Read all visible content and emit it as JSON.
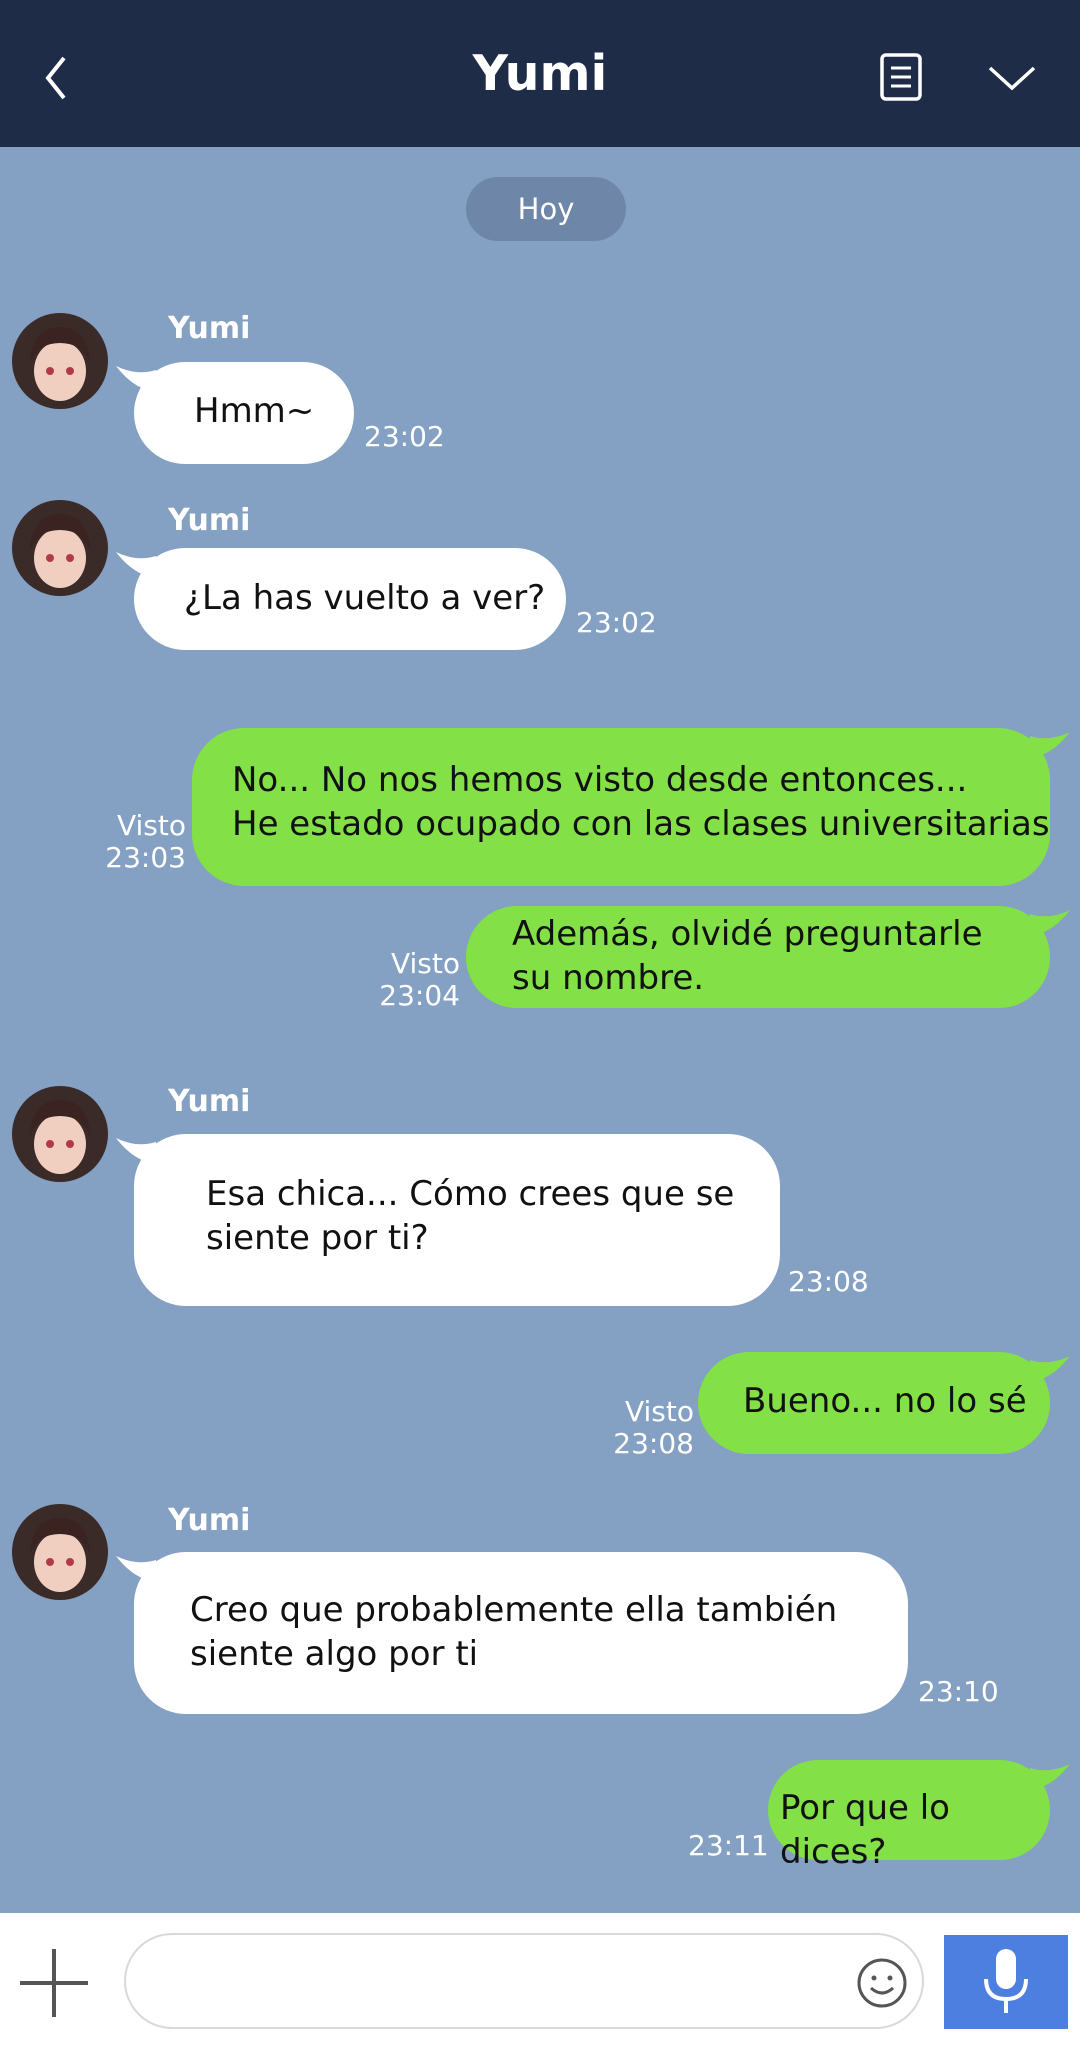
{
  "header": {
    "title": "Yumi",
    "back_icon": "chevron-left-icon",
    "notes_icon": "notes-icon",
    "menu_icon": "chevron-down-icon"
  },
  "chat": {
    "date_label": "Hoy",
    "messages": [
      {
        "sender": "Yumi",
        "text": "Hmm~",
        "time": "23:02"
      },
      {
        "sender": "Yumi",
        "text": "¿La has vuelto a ver?",
        "time": "23:02"
      },
      {
        "lines": [
          "No... No nos hemos visto desde entonces...",
          "He estado ocupado con las clases universitarias"
        ],
        "status": "Visto",
        "time": "23:03"
      },
      {
        "lines": [
          "Además, olvidé preguntarle",
          "su nombre."
        ],
        "status": "Visto",
        "time": "23:04"
      },
      {
        "sender": "Yumi",
        "lines": [
          "Esa chica... Cómo crees que se",
          "siente por ti?"
        ],
        "time": "23:08"
      },
      {
        "text": "Bueno... no lo sé",
        "status": "Visto",
        "time": "23:08"
      },
      {
        "sender": "Yumi",
        "lines": [
          "Creo que probablemente ella también",
          "siente algo por ti"
        ],
        "time": "23:10"
      },
      {
        "text": "Por que lo dices?",
        "time": "23:11"
      }
    ]
  },
  "composer": {
    "placeholder": "",
    "plus_icon": "plus-icon",
    "emoji_icon": "emoji-icon",
    "mic_icon": "microphone-icon"
  },
  "colors": {
    "header_bg": "#1f2c47",
    "chat_bg": "#84a0c2",
    "outgoing_bubble": "#83e047",
    "incoming_bubble": "#ffffff",
    "mic_button": "#4d7fe0"
  }
}
